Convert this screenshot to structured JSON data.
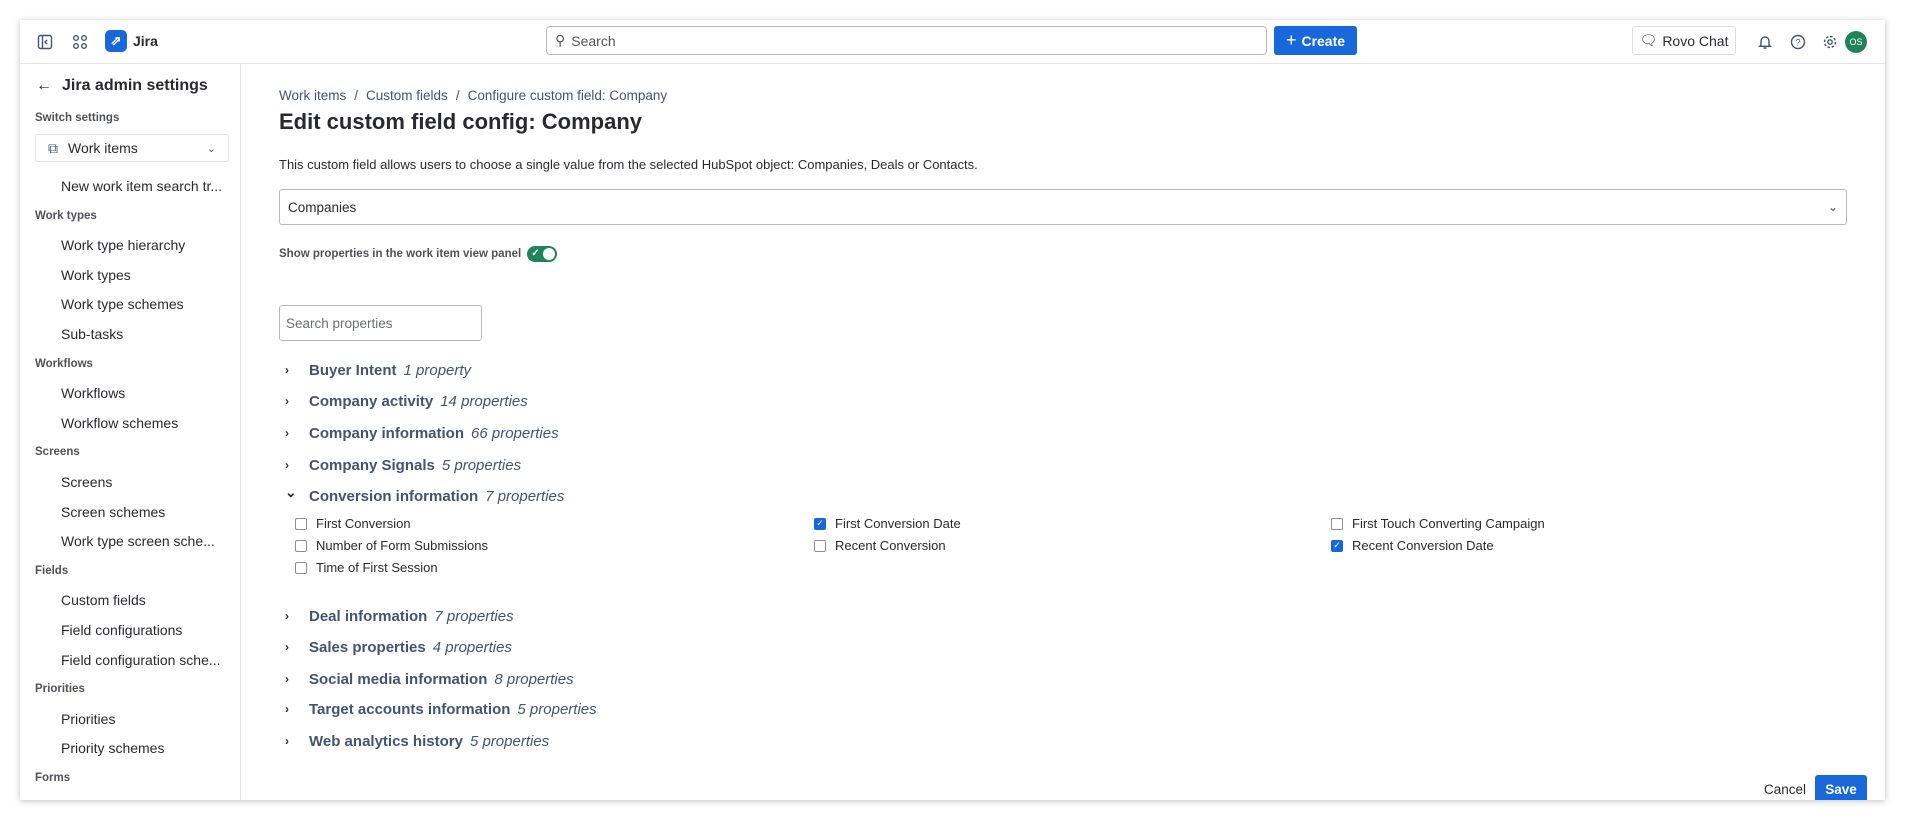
{
  "topbar": {
    "app_name": "Jira",
    "search_placeholder": "Search",
    "create_label": "Create",
    "rovo_label": "Rovo Chat",
    "avatar_initials": "OS"
  },
  "sidebar": {
    "title": "Jira admin settings",
    "switch_label": "Switch settings",
    "switch_value": "Work items",
    "items": [
      {
        "type": "item",
        "label": "New work item search tr..."
      },
      {
        "type": "section",
        "label": "Work types"
      },
      {
        "type": "item",
        "label": "Work type hierarchy"
      },
      {
        "type": "item",
        "label": "Work types"
      },
      {
        "type": "item",
        "label": "Work type schemes"
      },
      {
        "type": "item",
        "label": "Sub-tasks"
      },
      {
        "type": "section",
        "label": "Workflows"
      },
      {
        "type": "item",
        "label": "Workflows"
      },
      {
        "type": "item",
        "label": "Workflow schemes"
      },
      {
        "type": "section",
        "label": "Screens"
      },
      {
        "type": "item",
        "label": "Screens"
      },
      {
        "type": "item",
        "label": "Screen schemes"
      },
      {
        "type": "item",
        "label": "Work type screen sche..."
      },
      {
        "type": "section",
        "label": "Fields"
      },
      {
        "type": "item",
        "label": "Custom fields"
      },
      {
        "type": "item",
        "label": "Field configurations"
      },
      {
        "type": "item",
        "label": "Field configuration sche..."
      },
      {
        "type": "section",
        "label": "Priorities"
      },
      {
        "type": "item",
        "label": "Priorities"
      },
      {
        "type": "item",
        "label": "Priority schemes"
      },
      {
        "type": "section",
        "label": "Forms"
      }
    ]
  },
  "main": {
    "breadcrumb": [
      "Work items",
      "Custom fields",
      "Configure custom field: Company"
    ],
    "breadcrumb_sep": "/",
    "title": "Edit custom field config: Company",
    "description": "This custom field allows users to choose a single value from the selected HubSpot object: Companies, Deals or Contacts.",
    "object_select": "Companies",
    "toggle_label": "Show properties in the work item view panel",
    "toggle_on": true,
    "search_placeholder": "Search properties",
    "groups_before": [
      {
        "name": "Buyer Intent",
        "count": "1 property"
      },
      {
        "name": "Company activity",
        "count": "14 properties"
      },
      {
        "name": "Company information",
        "count": "66 properties"
      },
      {
        "name": "Company Signals",
        "count": "5 properties"
      }
    ],
    "expanded_group": {
      "name": "Conversion information",
      "count": "7 properties",
      "properties": [
        {
          "label": "First Conversion",
          "checked": false
        },
        {
          "label": "First Conversion Date",
          "checked": true
        },
        {
          "label": "First Touch Converting Campaign",
          "checked": false
        },
        {
          "label": "Number of Form Submissions",
          "checked": false
        },
        {
          "label": "Recent Conversion",
          "checked": false
        },
        {
          "label": "Recent Conversion Date",
          "checked": true
        },
        {
          "label": "Time of First Session",
          "checked": false
        }
      ]
    },
    "groups_after": [
      {
        "name": "Deal information",
        "count": "7 properties"
      },
      {
        "name": "Sales properties",
        "count": "4 properties"
      },
      {
        "name": "Social media information",
        "count": "8 properties"
      },
      {
        "name": "Target accounts information",
        "count": "5 properties"
      },
      {
        "name": "Web analytics history",
        "count": "5 properties"
      }
    ],
    "cancel_label": "Cancel",
    "save_label": "Save"
  },
  "colors": {
    "brand": "#1868db",
    "success": "#1f845a"
  }
}
